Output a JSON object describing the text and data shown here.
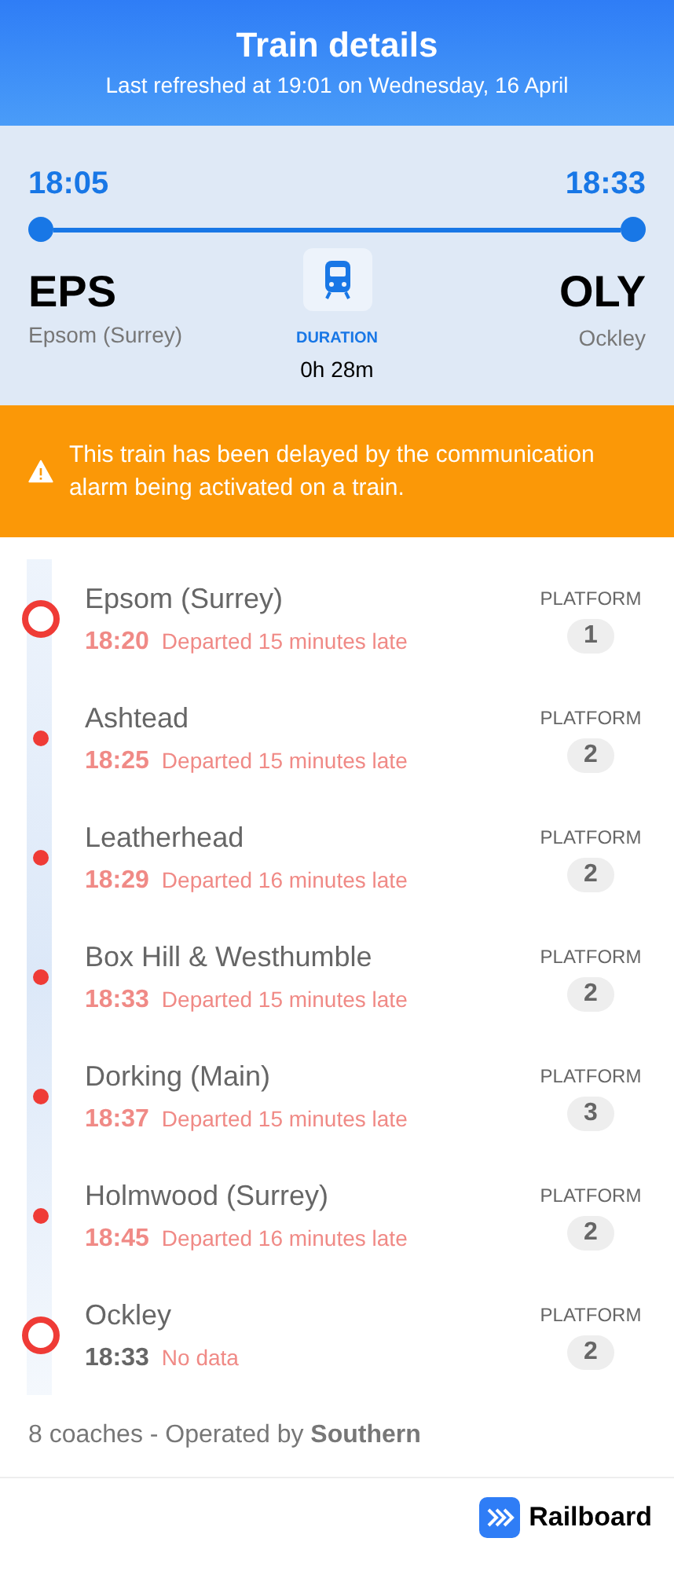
{
  "header": {
    "title": "Train details",
    "subtitle": "Last refreshed at 19:01 on Wednesday, 16 April"
  },
  "journey": {
    "departure_time": "18:05",
    "arrival_time": "18:33",
    "origin_code": "EPS",
    "origin_name": "Epsom (Surrey)",
    "destination_code": "OLY",
    "destination_name": "Ockley",
    "duration_label": "DURATION",
    "duration": "0h 28m"
  },
  "alert": {
    "message": "This train has been delayed by the communication alarm being activated on a train."
  },
  "stops": [
    {
      "kind": "terminal",
      "name": "Epsom (Surrey)",
      "time": "18:20",
      "delayed": true,
      "status": "Departed 15 minutes late",
      "platform_label": "PLATFORM",
      "platform": "1"
    },
    {
      "kind": "intermediate",
      "name": "Ashtead",
      "time": "18:25",
      "delayed": true,
      "status": "Departed 15 minutes late",
      "platform_label": "PLATFORM",
      "platform": "2"
    },
    {
      "kind": "intermediate",
      "name": "Leatherhead",
      "time": "18:29",
      "delayed": true,
      "status": "Departed 16 minutes late",
      "platform_label": "PLATFORM",
      "platform": "2"
    },
    {
      "kind": "intermediate",
      "name": "Box Hill & Westhumble",
      "time": "18:33",
      "delayed": true,
      "status": "Departed 15 minutes late",
      "platform_label": "PLATFORM",
      "platform": "2"
    },
    {
      "kind": "intermediate",
      "name": "Dorking (Main)",
      "time": "18:37",
      "delayed": true,
      "status": "Departed 15 minutes late",
      "platform_label": "PLATFORM",
      "platform": "3"
    },
    {
      "kind": "intermediate",
      "name": "Holmwood (Surrey)",
      "time": "18:45",
      "delayed": true,
      "status": "Departed 16 minutes late",
      "platform_label": "PLATFORM",
      "platform": "2"
    },
    {
      "kind": "terminal",
      "name": "Ockley",
      "time": "18:33",
      "delayed": false,
      "status": "No data",
      "platform_label": "PLATFORM",
      "platform": "2"
    }
  ],
  "footer": {
    "info": "8 coaches - Operated by **Southern**",
    "brand": "Railboard"
  }
}
